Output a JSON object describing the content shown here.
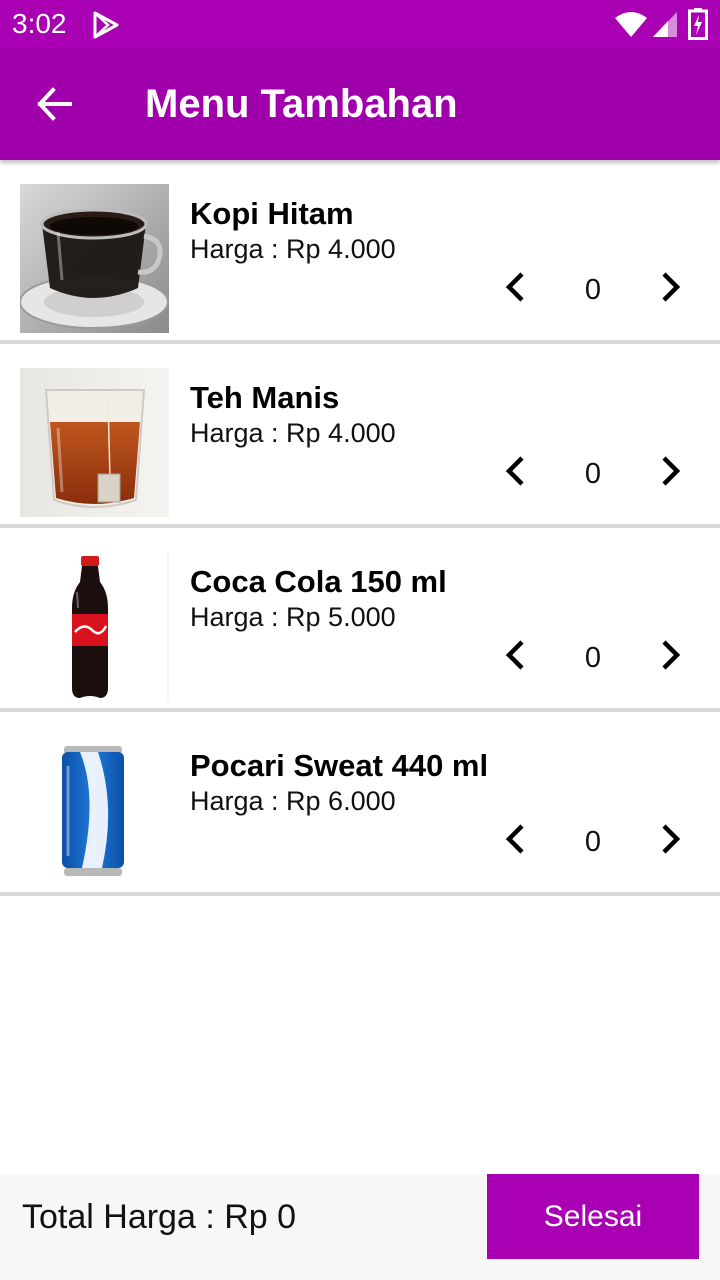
{
  "status_bar": {
    "time": "3:02",
    "icons": [
      "play-store-icon",
      "wifi-icon",
      "signal-icon",
      "battery-icon"
    ]
  },
  "app_bar": {
    "title": "Menu Tambahan",
    "back_icon": "arrow-left-icon"
  },
  "colors": {
    "primary": "#a000ab",
    "status_bar": "#aa00b4",
    "button": "#aa00b4",
    "divider": "#d7d7d7"
  },
  "menu": {
    "items": [
      {
        "name": "Kopi Hitam",
        "price": "Harga : Rp 4.000",
        "quantity": "0",
        "image": "black-coffee-cup"
      },
      {
        "name": "Teh Manis",
        "price": "Harga : Rp 4.000",
        "quantity": "0",
        "image": "sweet-tea-glass"
      },
      {
        "name": "Coca Cola 150 ml",
        "price": "Harga : Rp 5.000",
        "quantity": "0",
        "image": "coca-cola-bottle"
      },
      {
        "name": "Pocari Sweat 440 ml",
        "price": "Harga : Rp 6.000",
        "quantity": "0",
        "image": "pocari-sweat-can"
      }
    ],
    "decrease_icon": "chevron-left-icon",
    "increase_icon": "chevron-right-icon"
  },
  "footer": {
    "total": "Total Harga : Rp 0",
    "done_label": "Selesai"
  }
}
